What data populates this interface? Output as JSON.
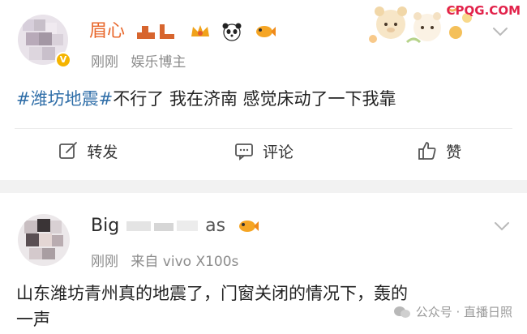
{
  "watermark": {
    "site": "CPQG.COM",
    "source": "公众号 · 直播日照"
  },
  "post1": {
    "username": "眉心",
    "time": "刚刚",
    "source": "娱乐博主",
    "hashtag": "#潍坊地震#",
    "text": "不行了 我在济南 感觉床动了一下我靠",
    "actions": {
      "repost": "转发",
      "comment": "评论",
      "like": "赞"
    },
    "icons": [
      "edit-share-icon",
      "comment-icon",
      "thumbs-up-icon",
      "chevron-down-icon",
      "verified-badge-icon",
      "panda-icon",
      "fish-icon",
      "crown-icon"
    ]
  },
  "post2": {
    "username": "Big",
    "username_tail": "as",
    "time": "刚刚",
    "source": "来自 vivo X100s",
    "text_line1": "山东潍坊青州真的地震了，门窗关闭的情况下，轰的",
    "text_line2": "一声",
    "icons": [
      "chevron-down-icon",
      "fish-icon"
    ]
  },
  "colors": {
    "username": "#e8662a",
    "hashtag": "#2f6ea8",
    "meta": "#8c8c8c",
    "watermark": "#e2234b"
  }
}
